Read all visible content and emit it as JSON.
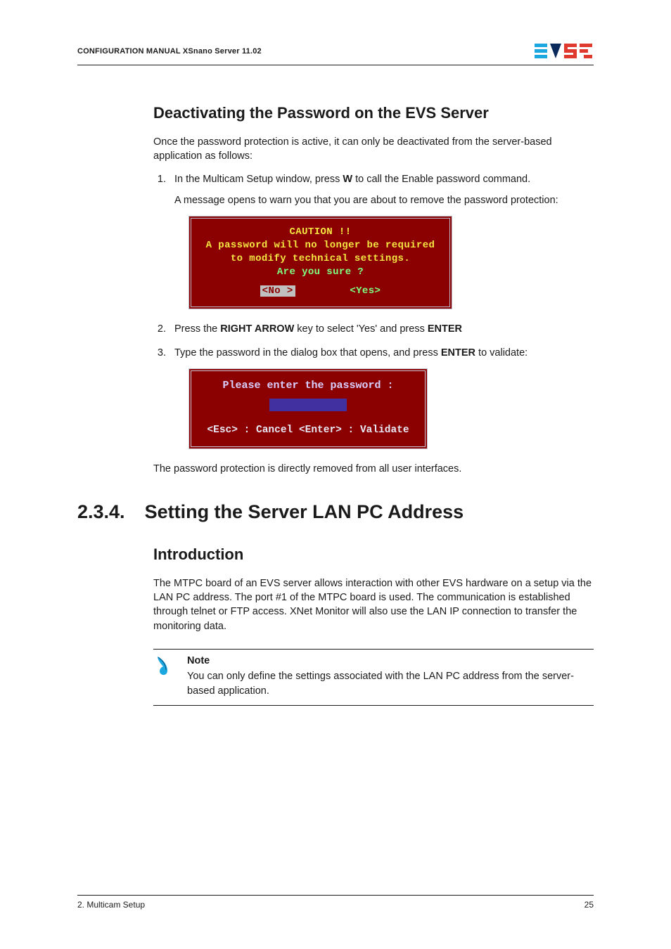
{
  "header": {
    "title": "CONFIGURATION MANUAL  XSnano Server 11.02",
    "logo_alt": "EVS"
  },
  "h2_deactivate": "Deactivating the Password on the EVS Server",
  "intro_para": "Once the password protection is active, it can only be deactivated from the server-based application as follows:",
  "steps": {
    "s1_a": "In the Multicam Setup window, press ",
    "s1_key": "W",
    "s1_b": " to call the Enable password command.",
    "s1_msg": "A message opens to warn you that you are about to remove the password protection:",
    "s2_a": "Press the ",
    "s2_key1": "RIGHT ARROW",
    "s2_b": " key to select 'Yes' and press ",
    "s2_key2": "ENTER",
    "s3_a": "Type the password in the dialog box that opens, and press ",
    "s3_key": "ENTER",
    "s3_b": " to validate:"
  },
  "dialog1": {
    "l1": "CAUTION !!",
    "l2": "A password will no longer be required",
    "l3": "to modify technical settings.",
    "l4": "Are you sure ?",
    "no": "<No >",
    "yes": "<Yes>"
  },
  "dialog2": {
    "prompt": "Please enter the password :",
    "bottom": "<Esc> : Cancel <Enter> : Validate"
  },
  "after_dialog2": "The password protection is directly removed from all user interfaces.",
  "section": {
    "num": "2.3.4.",
    "title": "Setting the Server LAN PC Address"
  },
  "h3_intro": "Introduction",
  "intro_body": "The MTPC board of an EVS server allows interaction with other EVS hardware on a setup via the LAN PC address. The port #1 of the MTPC board is used. The communication is established through telnet or FTP access. XNet Monitor will also use the LAN IP connection to transfer the monitoring data.",
  "note": {
    "title": "Note",
    "body": "You can only define the settings associated with the LAN PC address from the server-based application."
  },
  "footer": {
    "left": "2. Multicam Setup",
    "right": "25"
  }
}
